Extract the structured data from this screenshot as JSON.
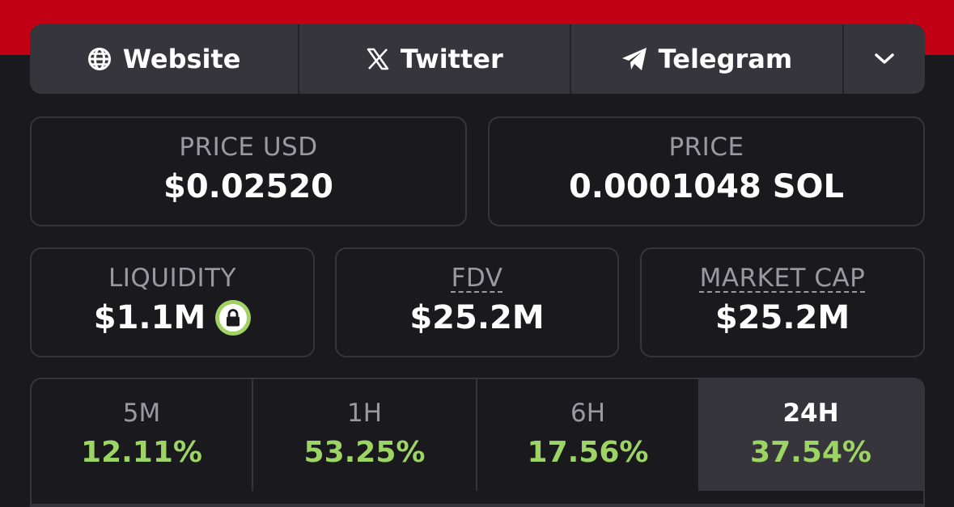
{
  "links": {
    "website": "Website",
    "twitter": "Twitter",
    "telegram": "Telegram"
  },
  "price_usd": {
    "label": "PRICE USD",
    "value": "$0.02520"
  },
  "price": {
    "label": "PRICE",
    "value": "0.0001048 SOL"
  },
  "liquidity": {
    "label": "LIQUIDITY",
    "value": "$1.1M"
  },
  "fdv": {
    "label": "FDV",
    "value": "$25.2M"
  },
  "market_cap": {
    "label": "MARKET CAP",
    "value": "$25.2M"
  },
  "timeframes": [
    {
      "label": "5M",
      "value": "12.11%"
    },
    {
      "label": "1H",
      "value": "53.25%"
    },
    {
      "label": "6H",
      "value": "17.56%"
    },
    {
      "label": "24H",
      "value": "37.54%"
    }
  ],
  "active_timeframe": "24H",
  "colors": {
    "accent_red": "#c10015",
    "positive_green": "#9dd565",
    "lock_green": "#a3d264"
  },
  "icons": [
    "globe-icon",
    "x-logo-icon",
    "telegram-icon",
    "chevron-down-icon",
    "lock-icon"
  ]
}
